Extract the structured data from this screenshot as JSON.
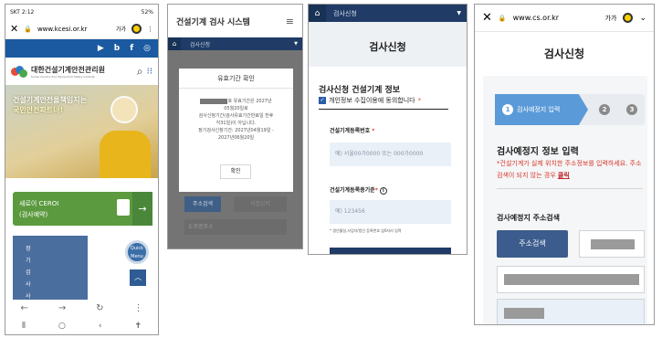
{
  "panel1": {
    "status": {
      "left": "SKT 2:12",
      "right": "52%"
    },
    "url": "www.kcesi.or.kr",
    "lang": "가가",
    "social": [
      "▶",
      "b",
      "f",
      "◎"
    ],
    "logo_name": "대한건설기계안전관리원",
    "logo_sub": "Korea Construction Equipment Safety Institute",
    "hero_line1": "건설기계안전을책임지는",
    "hero_line2": "국민안전파트너!",
    "cta_line1": "새로이 CEROI",
    "cta_line2": "(검사예약)",
    "side_nav": "정기검사사",
    "quick_menu": "Quick Menu"
  },
  "panel2": {
    "title": "건설기계 검사 시스템",
    "breadcrumb": "검사신청",
    "modal_title": "유효기간 확인",
    "modal_line1": "호 유효기간은 2027년",
    "modal_line2": "05월20일로",
    "modal_line3": "검사신청기간(검사유효기간만료일 전후",
    "modal_line4": "각31일)이 아닙니다.",
    "modal_line5": "정기검사신청기간: 2027년04월19일 -",
    "modal_line6": "2027년06월20일",
    "modal_ok": "확인",
    "btn_search": "주소검색",
    "btn_direct": "직접입력",
    "road_field": "도로명주소"
  },
  "panel3": {
    "breadcrumb": "검사신청",
    "page_title": "검사신청",
    "section_title": "검사신청 건설기계 정보",
    "consent": "개인정보 수집이용에 동의합니다",
    "reg_label": "건설기계등록번호",
    "reg_placeholder": "예) 서울00가0000 또는 000가0000",
    "id_label": "건설기계등록증기준",
    "id_placeholder": "예) 123456",
    "id_note": "* 생년월일,사업자/법인 등록번호 앞6자리 입력"
  },
  "panel4": {
    "url": "www.cs.or.kr",
    "lang": "가가",
    "page_title": "검사신청",
    "step1": "검사예정지 입력",
    "step2": "2",
    "step3": "3",
    "section_title": "검사예정지 정보 입력",
    "warning": "*건설기계가 실제 위치한 주소정보를 입력하세요. 주소검색이 되지 않는 경우",
    "warning_link": "클릭",
    "addr_label": "검사예정지 주소검색",
    "addr_button": "주소검색"
  },
  "colors": {
    "navy": "#1f3b66",
    "blue_step": "#5a9ad8",
    "warn_red": "#d8372b",
    "green_cta": "#5b9a3e"
  }
}
